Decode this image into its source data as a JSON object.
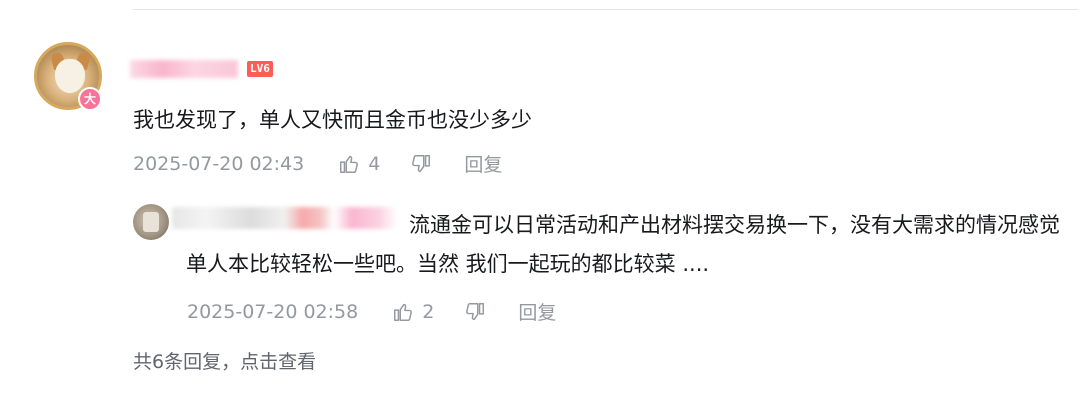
{
  "comment": {
    "avatar_badge": "大",
    "level": "LV6",
    "text": "我也发现了，单人又快而且金币也没少多少",
    "time": "2025-07-20 02:43",
    "likes": "4",
    "reply_label": "回复"
  },
  "reply": {
    "text": "流通金可以日常活动和产出材料摆交易换一下，没有大需求的情况感觉单人本比较轻松一些吧。当然 我们一起玩的都比较菜 ....",
    "time": "2025-07-20 02:58",
    "likes": "2",
    "reply_label": "回复"
  },
  "more_replies": "共6条回复，点击查看",
  "icons": {
    "like": "thumbs-up-icon",
    "dislike": "thumbs-down-icon"
  },
  "colors": {
    "accent_pink": "#fb7299",
    "level_red": "#fd5c57",
    "meta_gray": "#9499a0"
  }
}
